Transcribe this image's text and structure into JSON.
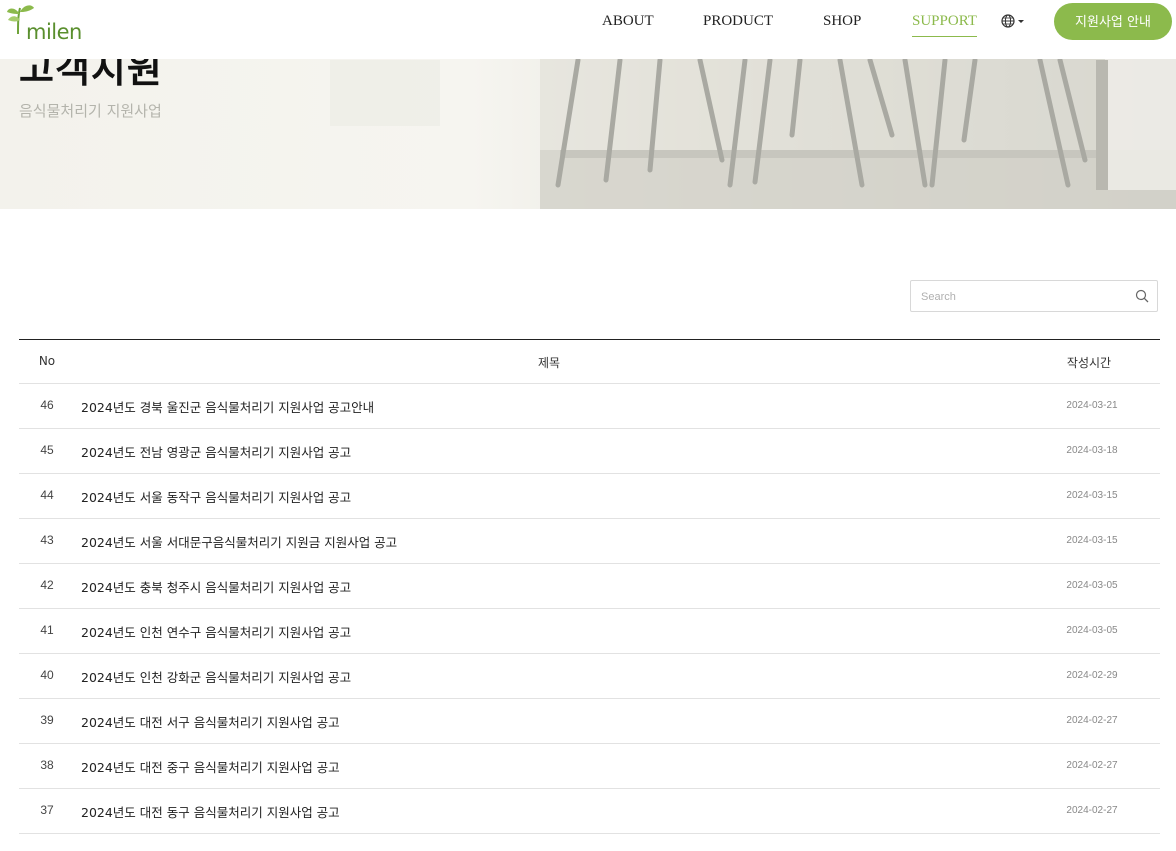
{
  "brand": {
    "logo_text": "milen",
    "accent_color": "#8cba4c"
  },
  "nav": {
    "items": [
      {
        "label": "ABOUT",
        "active": false
      },
      {
        "label": "PRODUCT",
        "active": false
      },
      {
        "label": "SHOP",
        "active": false
      },
      {
        "label": "SUPPORT",
        "active": true
      }
    ],
    "language_icon": "globe-icon",
    "cta_label": "지원사업 안내"
  },
  "hero": {
    "title": "고객지원",
    "subtitle": "음식물처리기 지원사업"
  },
  "search": {
    "placeholder": "Search",
    "value": "",
    "icon": "search-icon"
  },
  "table": {
    "headers": {
      "no": "No",
      "title": "제목",
      "date": "작성시간"
    },
    "rows": [
      {
        "no": "46",
        "title": "2024년도 경북 울진군 음식물처리기 지원사업 공고안내",
        "date": "2024-03-21"
      },
      {
        "no": "45",
        "title": "2024년도 전남 영광군 음식물처리기 지원사업 공고",
        "date": "2024-03-18"
      },
      {
        "no": "44",
        "title": "2024년도 서울 동작구 음식물처리기 지원사업 공고",
        "date": "2024-03-15"
      },
      {
        "no": "43",
        "title": "2024년도 서울 서대문구음식물처리기 지원금 지원사업 공고",
        "date": "2024-03-15"
      },
      {
        "no": "42",
        "title": "2024년도 충북 청주시 음식물처리기 지원사업 공고",
        "date": "2024-03-05"
      },
      {
        "no": "41",
        "title": "2024년도 인천 연수구 음식물처리기 지원사업 공고",
        "date": "2024-03-05"
      },
      {
        "no": "40",
        "title": "2024년도 인천 강화군 음식물처리기 지원사업 공고",
        "date": "2024-02-29"
      },
      {
        "no": "39",
        "title": "2024년도 대전 서구 음식물처리기 지원사업 공고",
        "date": "2024-02-27"
      },
      {
        "no": "38",
        "title": "2024년도 대전 중구 음식물처리기 지원사업 공고",
        "date": "2024-02-27"
      },
      {
        "no": "37",
        "title": "2024년도 대전 동구 음식물처리기 지원사업 공고",
        "date": "2024-02-27"
      }
    ]
  }
}
